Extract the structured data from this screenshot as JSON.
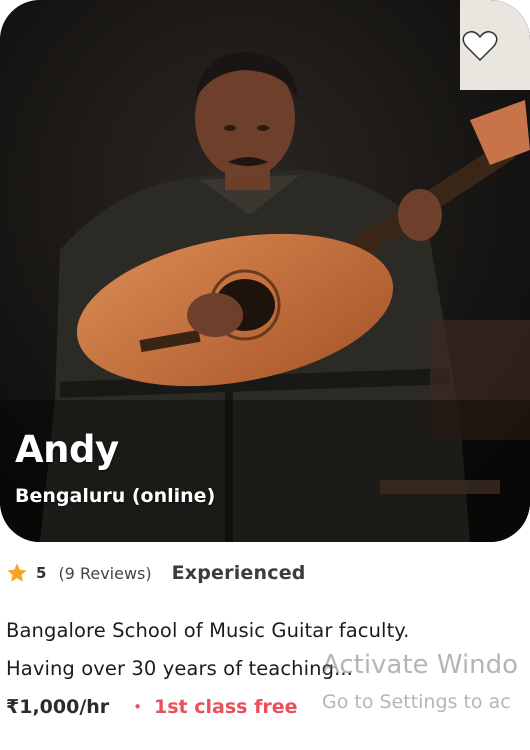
{
  "teacher": {
    "name": "Andy",
    "location": "Bengaluru (online)",
    "rating": "5",
    "reviews": "(9 Reviews)",
    "level": "Experienced",
    "description_line1": "Bangalore School of Music Guitar faculty.",
    "description_line2": "Having over 30 years of teaching...",
    "price": "₹1,000/hr",
    "offer_separator": "•",
    "offer": "1st class free"
  },
  "photo": {
    "subject": "man playing classical guitar",
    "icon": "photo"
  },
  "favorite": {
    "icon": "heart-icon",
    "active": false
  },
  "os_watermark": {
    "title": "Activate Windo",
    "subtitle": "Go to Settings to ac"
  },
  "colors": {
    "accent": "#e8505b",
    "star": "#f5a623",
    "text": "#1c1c1c"
  }
}
